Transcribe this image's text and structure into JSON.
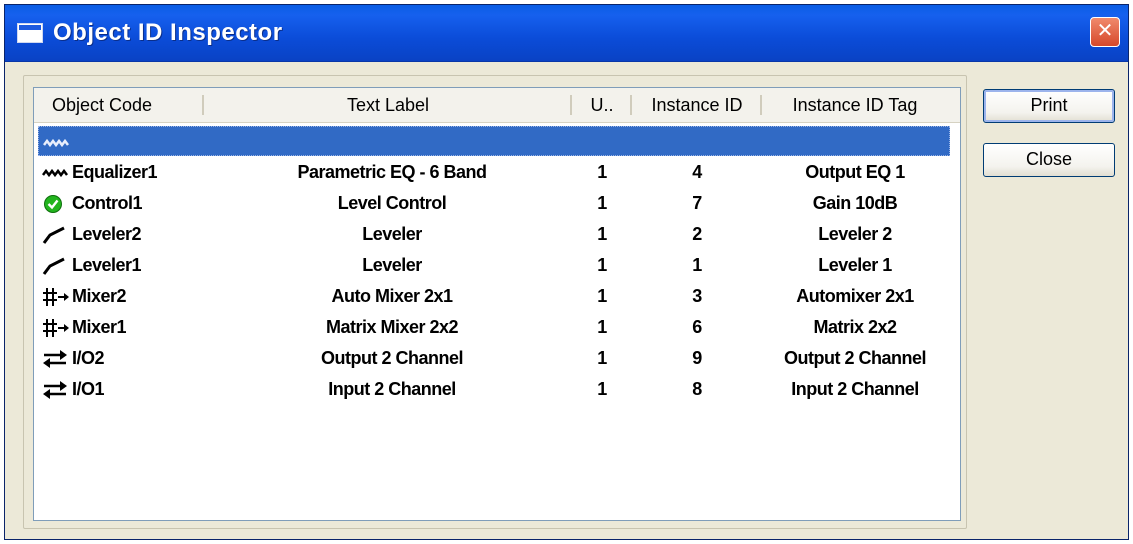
{
  "window": {
    "title": "Object ID Inspector",
    "close_glyph": "✕"
  },
  "list": {
    "columns": {
      "object_code": "Object Code",
      "text_label": "Text Label",
      "u": "U..",
      "instance_id": "Instance ID",
      "instance_id_tag": "Instance ID Tag"
    },
    "rows": [
      {
        "icon": "equalizer-icon",
        "object_code": "",
        "text_label": "",
        "u": "",
        "instance_id": "",
        "instance_id_tag": "",
        "selected": true
      },
      {
        "icon": "equalizer-icon",
        "object_code": "Equalizer1",
        "text_label": "Parametric EQ - 6 Band",
        "u": "1",
        "instance_id": "4",
        "instance_id_tag": "Output EQ 1",
        "selected": false
      },
      {
        "icon": "control-check-icon",
        "object_code": "Control1",
        "text_label": "Level Control",
        "u": "1",
        "instance_id": "7",
        "instance_id_tag": "Gain 10dB",
        "selected": false
      },
      {
        "icon": "leveler-icon",
        "object_code": "Leveler2",
        "text_label": "Leveler",
        "u": "1",
        "instance_id": "2",
        "instance_id_tag": "Leveler 2",
        "selected": false
      },
      {
        "icon": "leveler-icon",
        "object_code": "Leveler1",
        "text_label": "Leveler",
        "u": "1",
        "instance_id": "1",
        "instance_id_tag": "Leveler 1",
        "selected": false
      },
      {
        "icon": "mixer-icon",
        "object_code": "Mixer2",
        "text_label": "Auto Mixer 2x1",
        "u": "1",
        "instance_id": "3",
        "instance_id_tag": "Automixer 2x1",
        "selected": false
      },
      {
        "icon": "mixer-icon",
        "object_code": "Mixer1",
        "text_label": "Matrix Mixer 2x2",
        "u": "1",
        "instance_id": "6",
        "instance_id_tag": "Matrix 2x2",
        "selected": false
      },
      {
        "icon": "io-arrows-icon",
        "object_code": "I/O2",
        "text_label": "Output 2 Channel",
        "u": "1",
        "instance_id": "9",
        "instance_id_tag": "Output 2 Channel",
        "selected": false
      },
      {
        "icon": "io-arrows-icon",
        "object_code": "I/O1",
        "text_label": "Input 2 Channel",
        "u": "1",
        "instance_id": "8",
        "instance_id_tag": "Input 2 Channel",
        "selected": false
      }
    ]
  },
  "buttons": {
    "print": "Print",
    "close": "Close"
  },
  "colors": {
    "titlebar": "#0b4cd8",
    "selection": "#316ac5",
    "check_green": "#22b41e"
  }
}
